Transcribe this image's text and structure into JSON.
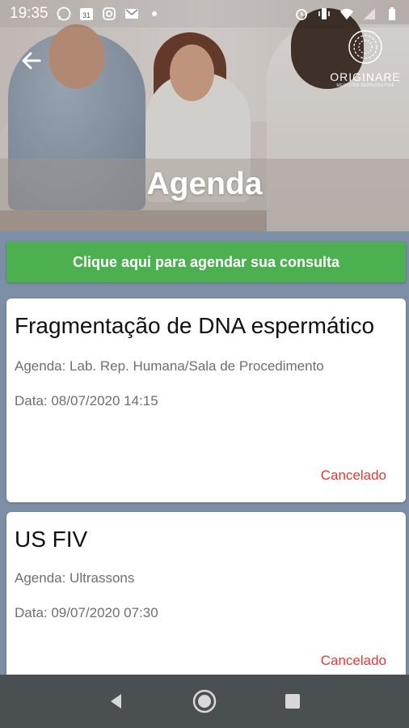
{
  "status_bar": {
    "time": "19:35",
    "left_icons": [
      "whatsapp-icon",
      "calendar-icon",
      "instagram-icon",
      "gmail-icon",
      "dot-icon"
    ],
    "calendar_day": "31",
    "right_icons": [
      "alarm-icon",
      "vibrate-icon",
      "wifi-icon",
      "signal-icon",
      "battery-icon"
    ]
  },
  "header": {
    "title": "Agenda",
    "logo_name": "ORIGINARE",
    "logo_sub": "MEDICINA REPRODUTIVA"
  },
  "cta": {
    "label": "Clique aqui para agendar sua consulta"
  },
  "appointments": [
    {
      "title": "Fragmentação de DNA espermático",
      "agenda": "Agenda: Lab. Rep. Humana/Sala de Procedimento",
      "date": "Data: 08/07/2020 14:15",
      "status": "Cancelado"
    },
    {
      "title": "US FIV",
      "agenda": "Agenda: Ultrassons",
      "date": "Data: 09/07/2020 07:30",
      "status": "Cancelado"
    }
  ],
  "colors": {
    "cta": "#4caf50",
    "status_cancelled": "#e53935",
    "background": "#7d8fa6",
    "navbar": "#4a4f52"
  }
}
